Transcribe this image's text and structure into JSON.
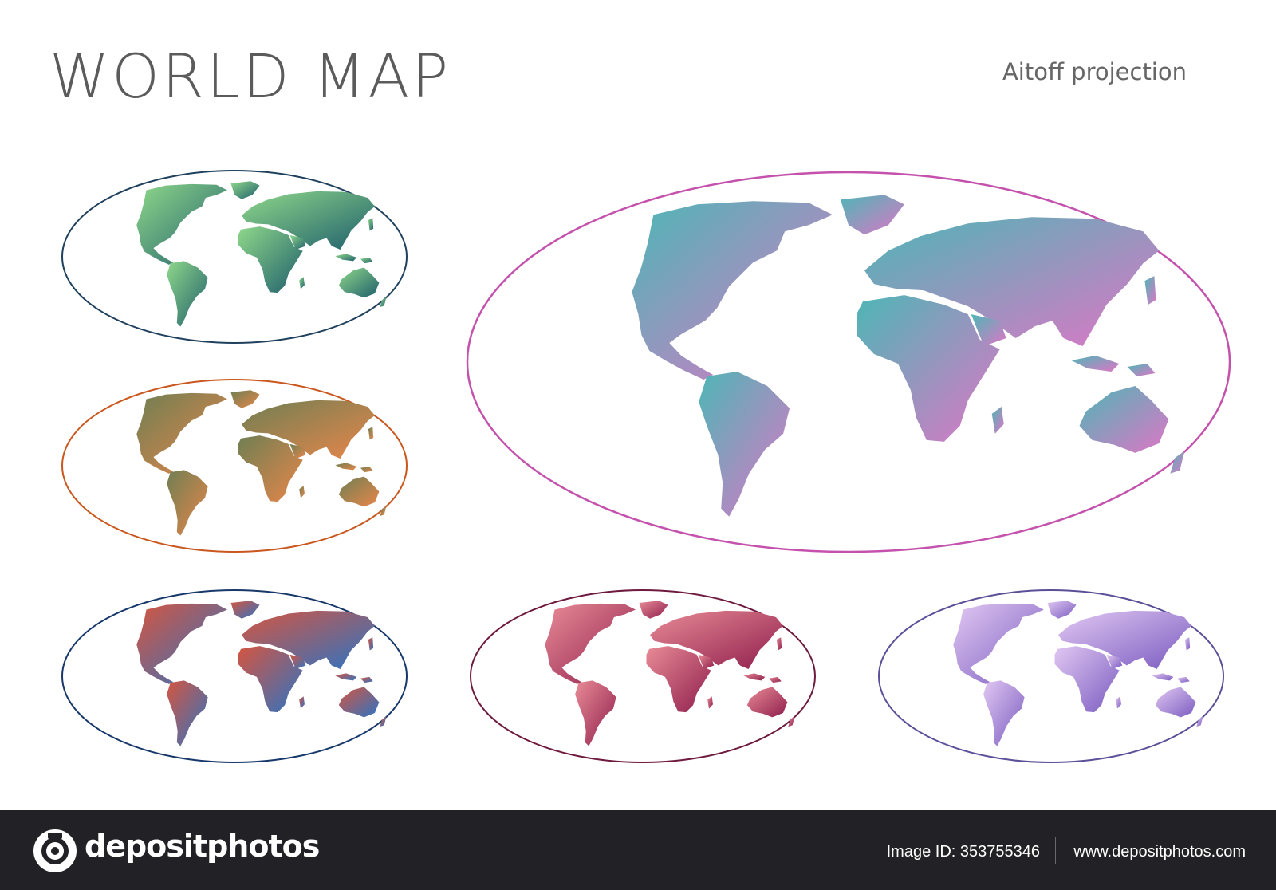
{
  "title": "WORLD MAP",
  "subtitle": "Aitoff projection",
  "maps": [
    {
      "name": "green-teal",
      "outline": "#20415e",
      "colors": [
        "#8fd88a",
        "#1f5e6c"
      ]
    },
    {
      "name": "olive-orange",
      "outline": "#c9571e",
      "colors": [
        "#6f7f53",
        "#e8864a"
      ]
    },
    {
      "name": "red-blue",
      "outline": "#17386a",
      "colors": [
        "#d5553f",
        "#2c74c4"
      ]
    },
    {
      "name": "pink-maroon",
      "outline": "#6e1a3e",
      "colors": [
        "#e88b96",
        "#8e1d4c"
      ]
    },
    {
      "name": "lilac-violet",
      "outline": "#5b4f98",
      "colors": [
        "#e1c8f2",
        "#7a5bc0"
      ]
    },
    {
      "name": "teal-pink-large",
      "outline": "#c452ad",
      "colors": [
        "#4db6b6",
        "#de76c6"
      ]
    }
  ],
  "footer": {
    "brand": "depositphotos",
    "image_id": "Image ID: 353755346",
    "site": "www.depositphotos.com"
  },
  "icons": {
    "logo": "camera-aperture-icon"
  }
}
